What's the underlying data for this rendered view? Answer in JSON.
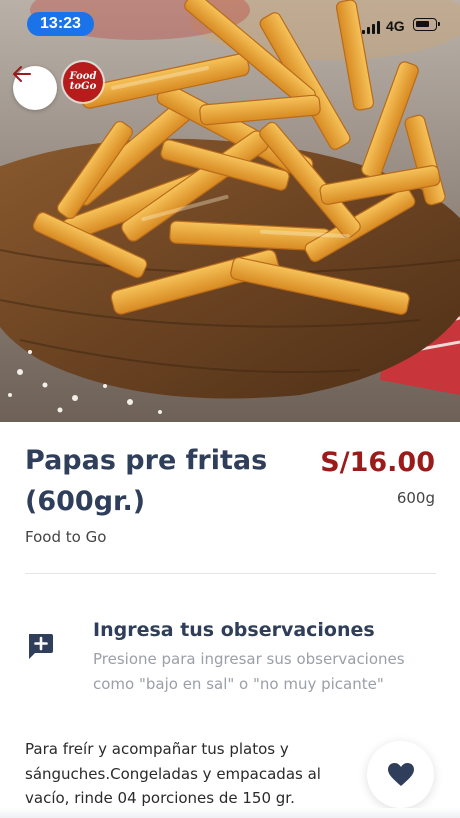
{
  "status_bar": {
    "time": "13:23",
    "network": "4G"
  },
  "header": {
    "back_icon": "arrow-left-icon",
    "logo_text_line1": "Food",
    "logo_text_line2": "toGo",
    "logo_color": "#b71c1c"
  },
  "product": {
    "title": "Papas pre fritas (600gr.)",
    "price": "S/16.00",
    "weight": "600g",
    "brand": "Food to Go",
    "description": "Para freír y acompañar tus platos y sánguches.Congeladas y empacadas al vacío, rinde 04 porciones de 150 gr."
  },
  "observations": {
    "icon": "add-comment-icon",
    "title": "Ingresa tus observaciones",
    "hint": "Presione para ingresar sus observaciones como \"bajo en sal\" o \"no muy picante\""
  },
  "favorite": {
    "icon": "heart-icon"
  },
  "colors": {
    "title": "#2f3e5a",
    "price": "#9b1a1a",
    "accent_blue": "#1a73e8",
    "hint_text": "#9a9fa8"
  }
}
